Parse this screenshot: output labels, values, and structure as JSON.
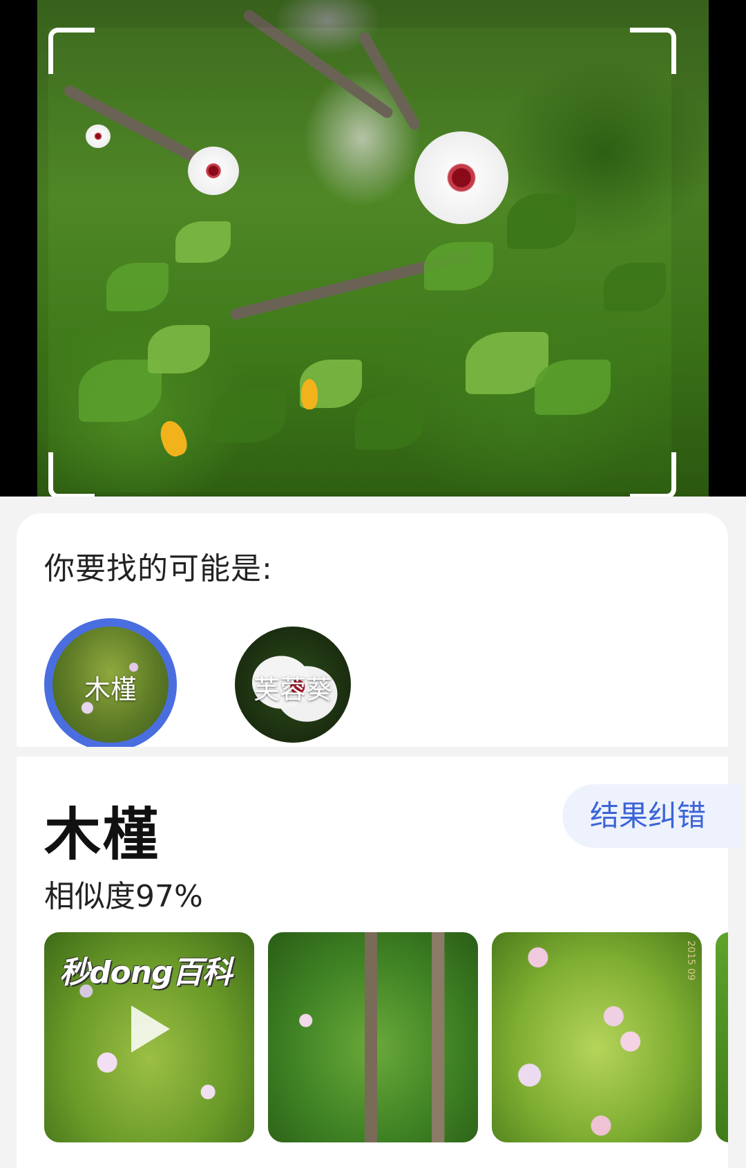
{
  "result": {
    "prompt": "你要找的可能是:",
    "candidates": [
      {
        "label": "木槿",
        "selected": true
      },
      {
        "label": "芙蓉葵",
        "selected": false
      }
    ],
    "name": "木槿",
    "similarity": "相似度97%",
    "correct_button": "结果纠错",
    "thumbnails": {
      "brand": "秒dong百科",
      "date_stamp": "2015 09"
    }
  },
  "colors": {
    "accent": "#4a6ee0",
    "button_bg": "#eef2fd",
    "button_text": "#3c64d8"
  }
}
